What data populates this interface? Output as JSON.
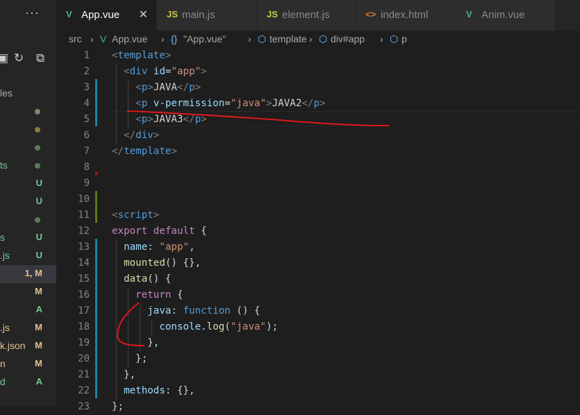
{
  "explorer": {
    "more": "···",
    "section_label": "les",
    "rows": [
      {
        "name": "",
        "badge": "",
        "dot": "#8b7f6a"
      },
      {
        "name": "",
        "badge": "",
        "dot": "#8b7d3a"
      },
      {
        "name": "",
        "badge": "",
        "dot": "#5a7a56"
      },
      {
        "name": "ts",
        "badge": "",
        "dot": "#5a7a56",
        "name_color": "#73c991"
      },
      {
        "name": "",
        "badge": "U",
        "name_color": "#73c991",
        "badge_color": "#73c991"
      },
      {
        "name": "",
        "badge": "U",
        "name_color": "#73c991",
        "badge_color": "#73c991"
      },
      {
        "name": "",
        "badge": "",
        "dot": "#5a7a56"
      },
      {
        "name": "s",
        "badge": "U",
        "name_color": "#73c991",
        "badge_color": "#73c991"
      },
      {
        "name": ".js",
        "badge": "U",
        "name_color": "#73c991",
        "badge_color": "#73c991"
      },
      {
        "name": "",
        "badge": "1, M",
        "name_color": "#e2c08d",
        "badge_color": "#e2c08d",
        "selected": true
      },
      {
        "name": "",
        "badge": "M",
        "name_color": "#e2c08d",
        "badge_color": "#e2c08d"
      },
      {
        "name": "",
        "badge": "A",
        "name_color": "#73c991",
        "badge_color": "#73c991"
      },
      {
        "name": ".js",
        "badge": "M",
        "name_color": "#e2c08d",
        "badge_color": "#e2c08d"
      },
      {
        "name": "k.json",
        "badge": "M",
        "name_color": "#e2c08d",
        "badge_color": "#e2c08d"
      },
      {
        "name": "n",
        "badge": "M",
        "name_color": "#e2c08d",
        "badge_color": "#e2c08d"
      },
      {
        "name": "d",
        "badge": "A",
        "name_color": "#73c991",
        "badge_color": "#73c991"
      }
    ]
  },
  "tabs": [
    {
      "label": "App.vue",
      "icon": "vue-icon",
      "icon_glyph": "V",
      "icon_color": "#41b883",
      "active": true,
      "close": "✕"
    },
    {
      "label": "main.js",
      "icon": "js-icon",
      "icon_glyph": "JS",
      "icon_color": "#cbcb41"
    },
    {
      "label": "element.js",
      "icon": "js-icon",
      "icon_glyph": "JS",
      "icon_color": "#cbcb41"
    },
    {
      "label": "index.html",
      "icon": "html-icon",
      "icon_glyph": "<>",
      "icon_color": "#e37933"
    },
    {
      "label": "Anim.vue",
      "icon": "vue-icon",
      "icon_glyph": "V",
      "icon_color": "#41b883"
    }
  ],
  "breadcrumb": {
    "items": [
      {
        "label": "src",
        "icon": ""
      },
      {
        "label": "App.vue",
        "icon": "vue"
      },
      {
        "label": "\"App.vue\"",
        "icon": "braces"
      },
      {
        "label": "template",
        "icon": "cube"
      },
      {
        "label": "div#app",
        "icon": "cube"
      },
      {
        "label": "p",
        "icon": "cube"
      }
    ],
    "separator": "›"
  },
  "colors": {
    "tag": "#808080",
    "tagname": "#569cd6",
    "attr": "#9cdcfe",
    "string": "#ce9178",
    "keyword": "#c586c0",
    "text": "#d4d4d4",
    "func": "#dcdcaa",
    "plain": "#d4d4d4",
    "modified": "#1b81a8",
    "added": "#587c0c",
    "annotation": "#e01818"
  },
  "editor": {
    "first_line_number": 1,
    "lines": [
      [
        [
          "<",
          "tag"
        ],
        [
          "template",
          "tagname"
        ],
        [
          ">",
          "tag"
        ]
      ],
      [
        [
          "  ",
          ""
        ],
        [
          "<",
          "tag"
        ],
        [
          "div",
          "tagname"
        ],
        [
          " ",
          ""
        ],
        [
          "id",
          "attr"
        ],
        [
          "=",
          "plain"
        ],
        [
          "\"app\"",
          "string"
        ],
        [
          ">",
          "tag"
        ]
      ],
      [
        [
          "    ",
          ""
        ],
        [
          "<",
          "tag"
        ],
        [
          "p",
          "tagname"
        ],
        [
          ">",
          "tag"
        ],
        [
          "JAVA",
          "text"
        ],
        [
          "</",
          "tag"
        ],
        [
          "p",
          "tagname"
        ],
        [
          ">",
          "tag"
        ]
      ],
      [
        [
          "    ",
          ""
        ],
        [
          "<",
          "tag"
        ],
        [
          "p",
          "tagname"
        ],
        [
          " ",
          ""
        ],
        [
          "v-permission",
          "attr"
        ],
        [
          "=",
          "plain"
        ],
        [
          "\"java\"",
          "string"
        ],
        [
          ">",
          "tag"
        ],
        [
          "JAVA2",
          "text"
        ],
        [
          "</",
          "tag"
        ],
        [
          "p",
          "tagname"
        ],
        [
          ">",
          "tag"
        ]
      ],
      [
        [
          "    ",
          ""
        ],
        [
          "<",
          "tag"
        ],
        [
          "p",
          "tagname"
        ],
        [
          ">",
          "tag"
        ],
        [
          "JAVA3",
          "text"
        ],
        [
          "</",
          "tag"
        ],
        [
          "p",
          "tagname"
        ],
        [
          ">",
          "tag"
        ]
      ],
      [
        [
          "  ",
          ""
        ],
        [
          "</",
          "tag"
        ],
        [
          "div",
          "tagname"
        ],
        [
          ">",
          "tag"
        ]
      ],
      [
        [
          "</",
          "tag"
        ],
        [
          "template",
          "tagname"
        ],
        [
          ">",
          "tag"
        ]
      ],
      [],
      [],
      [],
      [
        [
          "<",
          "tag"
        ],
        [
          "script",
          "tagname"
        ],
        [
          ">",
          "tag"
        ]
      ],
      [
        [
          "export default",
          "keyword"
        ],
        [
          " {",
          "plain"
        ]
      ],
      [
        [
          "  name",
          "attr"
        ],
        [
          ": ",
          "plain"
        ],
        [
          "\"app\"",
          "string"
        ],
        [
          ",",
          "plain"
        ]
      ],
      [
        [
          "  mounted",
          "func"
        ],
        [
          "() {},",
          "plain"
        ]
      ],
      [
        [
          "  data",
          "func"
        ],
        [
          "() {",
          "plain"
        ]
      ],
      [
        [
          "    return",
          "keyword"
        ],
        [
          " {",
          "plain"
        ]
      ],
      [
        [
          "      java",
          "attr"
        ],
        [
          ": ",
          "plain"
        ],
        [
          "function",
          "tagname"
        ],
        [
          " () {",
          "plain"
        ]
      ],
      [
        [
          "        console",
          "attr"
        ],
        [
          ".",
          "plain"
        ],
        [
          "log",
          "func"
        ],
        [
          "(",
          "plain"
        ],
        [
          "\"java\"",
          "string"
        ],
        [
          ");",
          "plain"
        ]
      ],
      [
        [
          "      },",
          "plain"
        ]
      ],
      [
        [
          "    };",
          "plain"
        ]
      ],
      [
        [
          "  },",
          "plain"
        ]
      ],
      [
        [
          "  methods",
          "attr"
        ],
        [
          ": {},",
          "plain"
        ]
      ],
      [
        [
          "};",
          "plain"
        ]
      ]
    ]
  }
}
